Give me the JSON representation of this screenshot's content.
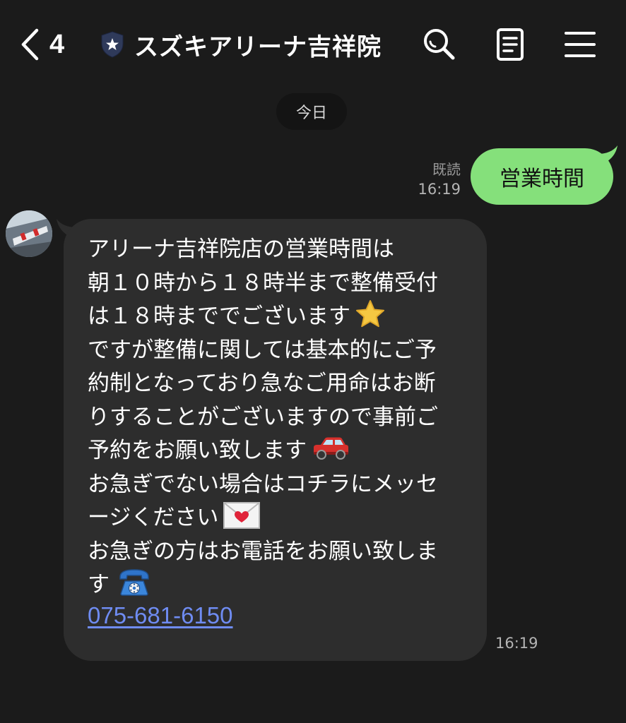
{
  "header": {
    "back_icon": "chevron-left-icon",
    "unread_count": "4",
    "badge_icon": "shield-star-icon",
    "title": "スズキアリーナ吉祥院",
    "actions": [
      "search-icon",
      "note-icon",
      "menu-icon"
    ]
  },
  "date_separator": "今日",
  "outgoing_message": {
    "read_status": "既読",
    "time": "16:19",
    "text": "営業時間",
    "bubble_color": "#85e07b"
  },
  "incoming_message": {
    "avatar": "store-avatar",
    "lines": [
      {
        "text": "アリーナ吉祥院店の営業時間は"
      },
      {
        "text": "朝１０時から１８時半まで整備受付"
      },
      {
        "text": "は１８時まででございます",
        "emoji": "star-emoji"
      },
      {
        "text": "ですが整備に関しては基本的にご予"
      },
      {
        "text": "約制となっており急なご用命はお断"
      },
      {
        "text": "りすることがございますので事前ご"
      },
      {
        "text": "予約をお願い致します",
        "emoji": "car-emoji"
      },
      {
        "text": "お急ぎでない場合はコチラにメッセ"
      },
      {
        "text": "ージください",
        "emoji": "love-letter-emoji"
      },
      {
        "text": "お急ぎの方はお電話をお願い致しま"
      },
      {
        "text": "す",
        "emoji": "telephone-emoji"
      }
    ],
    "phone_link": "075-681-6150",
    "time": "16:19",
    "bubble_color": "#2d2d2d",
    "link_color": "#6f8cf2"
  }
}
